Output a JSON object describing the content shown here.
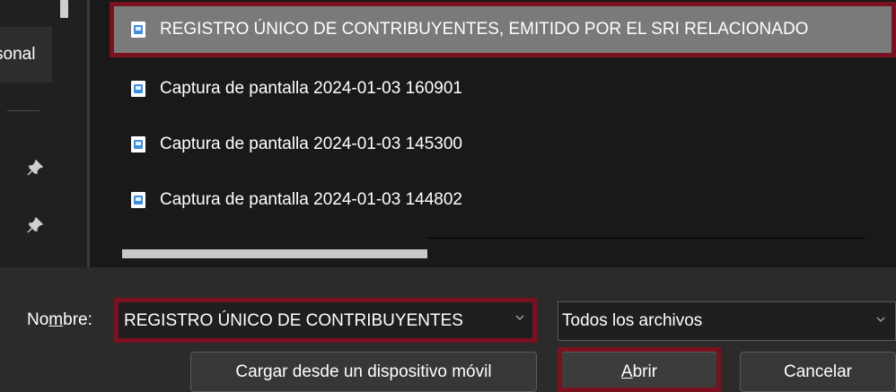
{
  "sidebar": {
    "item_label": "sonal",
    "pin_icon": "pin-icon"
  },
  "files": [
    {
      "name": "REGISTRO ÚNICO DE CONTRIBUYENTES, EMITIDO POR EL SRI RELACIONADO",
      "selected": true,
      "icon": "image-file-icon"
    },
    {
      "name": "Captura de pantalla 2024-01-03 160901",
      "selected": false,
      "icon": "image-file-icon"
    },
    {
      "name": "Captura de pantalla 2024-01-03 145300",
      "selected": false,
      "icon": "image-file-icon"
    },
    {
      "name": "Captura de pantalla 2024-01-03 144802",
      "selected": false,
      "icon": "image-file-icon"
    }
  ],
  "footer": {
    "name_label_pre": "No",
    "name_label_u": "m",
    "name_label_post": "bre:",
    "file_name_value": "REGISTRO ÚNICO DE CONTRIBUYENTES",
    "file_type_value": "Todos los archivos",
    "upload_button": "Cargar desde un dispositivo móvil",
    "open_button_u": "A",
    "open_button_rest": "brir",
    "cancel_button": "Cancelar"
  },
  "colors": {
    "highlight": "#7a1120",
    "selected_row": "#7a7a7a",
    "image_icon_blue": "#3f8fe0"
  }
}
